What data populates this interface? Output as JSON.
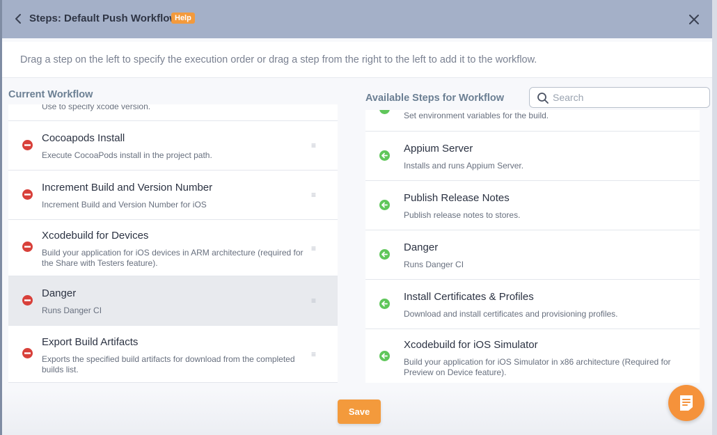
{
  "header": {
    "title": "Steps: Default Push Workflow",
    "help_label": "Help"
  },
  "instructions": "Drag a step on the left to specify the execution order or drag a step from the right to the left to add it to the workflow.",
  "current_workflow": {
    "title": "Current Workflow",
    "steps": [
      {
        "name": "",
        "description": "Use to specify xcode version."
      },
      {
        "name": "Cocoapods Install",
        "description": "Execute CocoaPods install in the project path."
      },
      {
        "name": "Increment Build and Version Number",
        "description": "Increment Build and Version Number for iOS"
      },
      {
        "name": "Xcodebuild for Devices",
        "description": "Build your application for iOS devices in ARM architecture (required for the Share with Testers feature)."
      },
      {
        "name": "Danger",
        "description": "Runs Danger CI"
      },
      {
        "name": "Export Build Artifacts",
        "description": "Exports the specified build artifacts for download from the completed builds list."
      }
    ]
  },
  "available_steps": {
    "title": "Available Steps for Workflow",
    "search_placeholder": "Search",
    "steps": [
      {
        "name": "",
        "description": "Set environment variables for the build."
      },
      {
        "name": "Appium Server",
        "description": "Installs and runs Appium Server."
      },
      {
        "name": "Publish Release Notes",
        "description": "Publish release notes to stores."
      },
      {
        "name": "Danger",
        "description": "Runs Danger CI"
      },
      {
        "name": "Install Certificates & Profiles",
        "description": "Download and install certificates and provisioning profiles."
      },
      {
        "name": "Xcodebuild for iOS Simulator",
        "description": "Build your application for iOS Simulator in x86 architecture (Required for Preview on Device feature)."
      }
    ]
  },
  "footer": {
    "save_label": "Save"
  },
  "icons": {
    "back": "chevron-left-icon",
    "close": "close-icon",
    "search": "search-icon",
    "remove": "minus-circle-icon",
    "add": "arrow-left-circle-icon",
    "drag": "drag-handle-icon",
    "chat": "chat-icon"
  },
  "colors": {
    "accent": "#f39a3c",
    "remove": "#d8403a",
    "add": "#5fc65a",
    "header_bg": "#a4b0c8"
  }
}
